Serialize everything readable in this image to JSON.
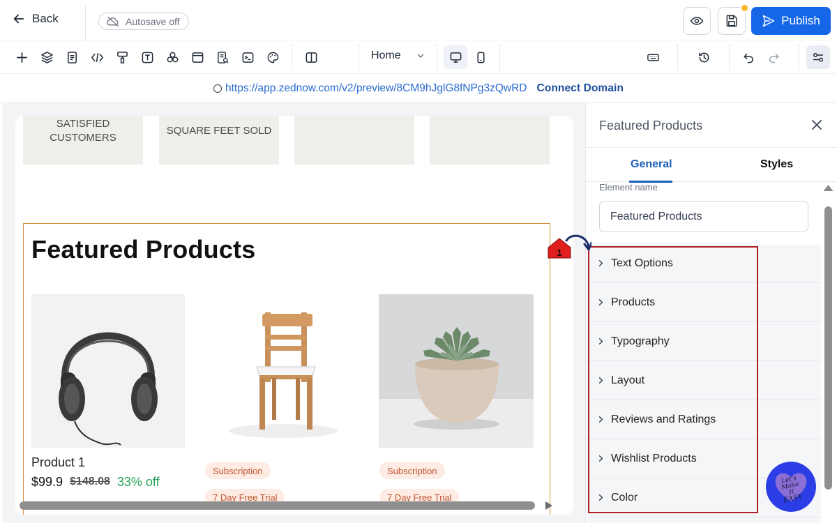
{
  "header": {
    "back_label": "Back",
    "autosave_label": "Autosave off",
    "publish_label": "Publish"
  },
  "toolbar": {
    "page_selected": "Home"
  },
  "url_bar": {
    "url": "https://app.zednow.com/v2/preview/8CM9hJglG8fNPg3zQwRD",
    "connect_domain_label": "Connect Domain"
  },
  "canvas": {
    "stats": [
      {
        "label": "SATISFIED CUSTOMERS"
      },
      {
        "label": "SQUARE FEET SOLD"
      },
      {
        "label": ""
      },
      {
        "label": ""
      }
    ],
    "section_title": "Featured Products",
    "products": [
      {
        "name": "Product 1",
        "price": "$99.9",
        "compare_price": "$148.08",
        "discount": "33% off",
        "image": "headphones"
      },
      {
        "badge": "Subscription",
        "badge2": "7 Day Free Trial",
        "image": "chair"
      },
      {
        "badge": "Subscription",
        "badge2": "7 Day Free Trial",
        "image": "succulent-pot"
      }
    ]
  },
  "panel": {
    "title": "Featured Products",
    "tabs": [
      {
        "label": "General",
        "active": true
      },
      {
        "label": "Styles",
        "active": false
      }
    ],
    "element_name_label": "Element name",
    "element_name_value": "Featured Products",
    "accordion": [
      {
        "label": "Text Options"
      },
      {
        "label": "Products"
      },
      {
        "label": "Typography"
      },
      {
        "label": "Layout"
      },
      {
        "label": "Reviews and Ratings"
      },
      {
        "label": "Wishlist Products"
      },
      {
        "label": "Color"
      }
    ]
  },
  "annotation": {
    "step_number": "1",
    "logo_text": [
      "Let's Make",
      "It",
      "EASY"
    ]
  },
  "colors": {
    "accent": "#1667e8",
    "section_outline": "#d9903a",
    "highlight_box": "#b01d25",
    "discount": "#27a35a",
    "badge_bg": "#fdebe4"
  }
}
